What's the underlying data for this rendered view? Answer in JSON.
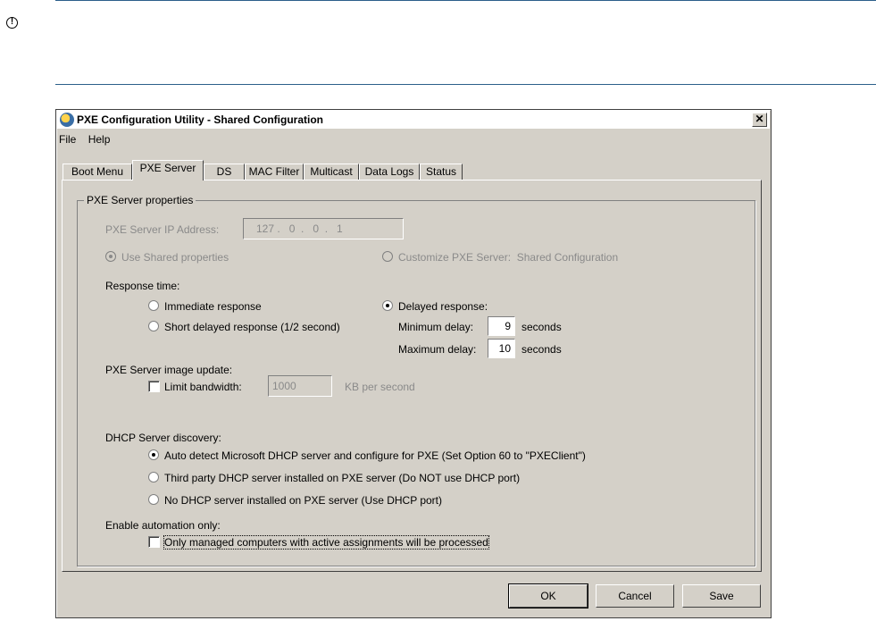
{
  "window": {
    "title": "PXE Configuration Utility - Shared Configuration",
    "close_glyph": "✕"
  },
  "menu": {
    "file": "File",
    "help": "Help"
  },
  "tabs": [
    "Boot Menu",
    "PXE Server",
    "DS",
    "MAC Filter",
    "Multicast",
    "Data Logs",
    "Status"
  ],
  "active_tab": "PXE Server",
  "group": {
    "legend": "PXE Server properties",
    "ip_label": "PXE Server IP Address:",
    "ip_value": "127 .   0  .   0  .   1",
    "use_shared": "Use Shared properties",
    "customize": "Customize PXE Server:",
    "customize_value": "Shared Configuration",
    "response_time": "Response time:",
    "immediate": "Immediate response",
    "short_delayed": "Short delayed response (1/2 second)",
    "delayed": "Delayed response:",
    "min_delay_label": "Minimum delay:",
    "min_delay_value": "9",
    "max_delay_label": "Maximum delay:",
    "max_delay_value": "10",
    "seconds": "seconds",
    "image_update": "PXE Server image update:",
    "limit_bandwidth": "Limit bandwidth:",
    "bandwidth_value": "1000",
    "kb_per_second": "KB per second",
    "dhcp_discovery": "DHCP Server discovery:",
    "dhcp_auto": "Auto detect Microsoft DHCP server and configure for PXE (Set Option 60 to \"PXEClient\")",
    "dhcp_third_party": "Third party DHCP server installed on PXE server (Do NOT use DHCP port)",
    "dhcp_none": "No DHCP server installed on PXE server (Use DHCP port)",
    "automation": "Enable automation only:",
    "managed_only": "Only managed computers with active assignments will be processed"
  },
  "buttons": {
    "ok": "OK",
    "cancel": "Cancel",
    "save": "Save"
  },
  "note_icon": "!"
}
